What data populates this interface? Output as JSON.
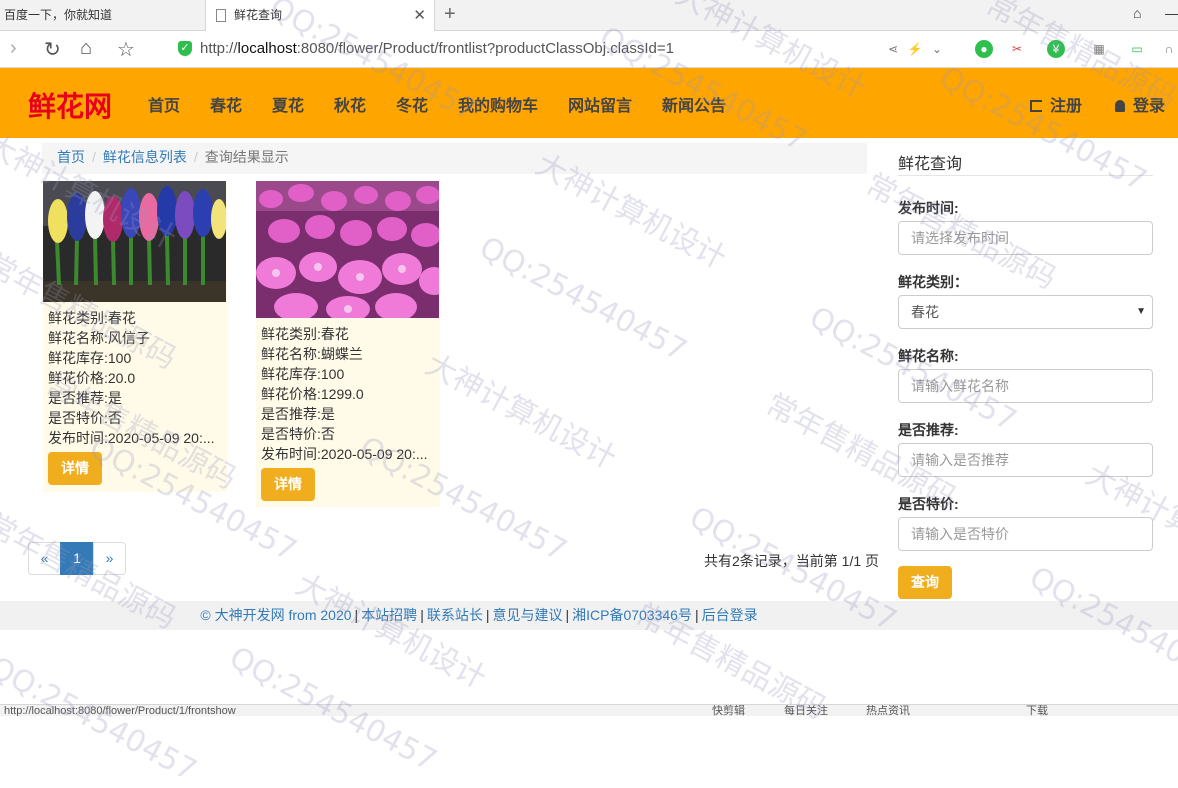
{
  "browser": {
    "tabs": [
      {
        "title": "百度一下，你就知道"
      },
      {
        "title": "鲜花查询"
      }
    ],
    "url_prefix": "http://",
    "url_host": "localhost",
    "url_rest": ":8080/flower/Product/frontlist?productClassObj.classId=1"
  },
  "site": {
    "logo": "鲜花网",
    "menu": [
      "首页",
      "春花",
      "夏花",
      "秋花",
      "冬花",
      "我的购物车",
      "网站留言",
      "新闻公告"
    ],
    "register": "注册",
    "login": "登录"
  },
  "breadcrumb": {
    "home": "首页",
    "list": "鲜花信息列表",
    "current": "查询结果显示"
  },
  "products": [
    {
      "category": "鲜花类别:春花",
      "name": "鲜花名称:风信子",
      "stock": "鲜花库存:100",
      "price": "鲜花价格:20.0",
      "recommend": "是否推荐:是",
      "special": "是否特价:否",
      "publish": "发布时间:2020-05-09 20:...",
      "button": "详情"
    },
    {
      "category": "鲜花类别:春花",
      "name": "鲜花名称:蝴蝶兰",
      "stock": "鲜花库存:100",
      "price": "鲜花价格:1299.0",
      "recommend": "是否推荐:是",
      "special": "是否特价:否",
      "publish": "发布时间:2020-05-09 20:...",
      "button": "详情"
    }
  ],
  "pagination": {
    "prev": "«",
    "current": "1",
    "next": "»",
    "info": "共有2条记录，当前第 1/1 页"
  },
  "query": {
    "title": "鲜花查询",
    "publish_label": "发布时间:",
    "publish_placeholder": "请选择发布时间",
    "category_label": "鲜花类别：",
    "category_value": "春花",
    "name_label": "鲜花名称:",
    "name_placeholder": "请输入鲜花名称",
    "recommend_label": "是否推荐:",
    "recommend_placeholder": "请输入是否推荐",
    "special_label": "是否特价:",
    "special_placeholder": "请输入是否特价",
    "button": "查询"
  },
  "footer": {
    "copyright": "© 大神开发网 from 2020",
    "links": [
      "本站招聘",
      "联系站长",
      "意见与建议",
      "湘ICP备0703346号",
      "后台登录"
    ]
  },
  "statusbar": {
    "url": "http://localhost:8080/flower/Product/1/frontshow",
    "items": [
      "快剪辑",
      "每日关注",
      "热点资讯",
      "下载"
    ]
  },
  "watermarks": [
    "QQ:254540457",
    "大神计算机设计",
    "常年售精品源码"
  ],
  "colors": {
    "header": "#ffa500",
    "logo": "#e8001c",
    "button": "#f0ad1e",
    "link": "#337ab7"
  }
}
